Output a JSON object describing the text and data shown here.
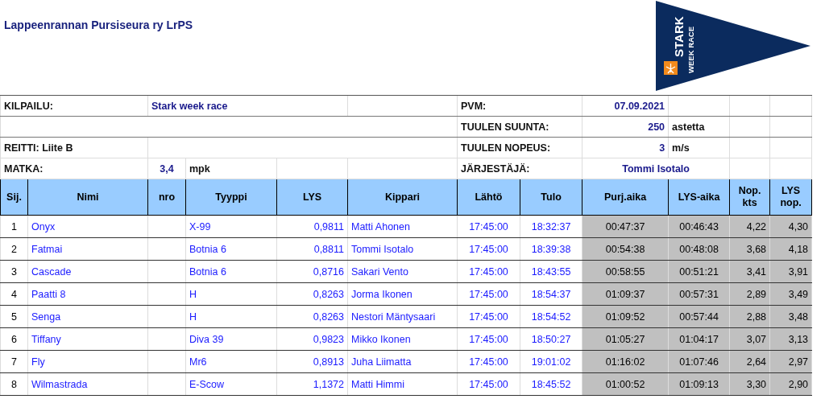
{
  "title": "Lappeenrannan Pursiseura ry LrPS",
  "logo": {
    "line_1": "STARK",
    "line_2": "WEEK RACE"
  },
  "race_info": {
    "race_label": "KILPAILU:",
    "race_name": "Stark week race",
    "route": "REITTI: Liite B",
    "distance_label": "MATKA:",
    "distance": "3,4",
    "distance_unit": "mpk",
    "date_label": "PVM:",
    "date": "07.09.2021",
    "wind_direction_label": "TUULEN SUUNTA:",
    "wind_direction": "250",
    "wind_direction_unit": "astetta",
    "wind_speed_label": "TUULEN NOPEUS:",
    "wind_speed": "3",
    "wind_speed_unit": "m/s",
    "organizer_label": "JÄRJESTÄJÄ:",
    "organizer": "Tommi Isotalo"
  },
  "table": {
    "columns": [
      "Sij.",
      "Nimi",
      "nro",
      "Tyyppi",
      "LYS",
      "Kippari",
      "Lähtö",
      "Tulo",
      "Purj.aika",
      "LYS-aika",
      "Nop. kts",
      "LYS nop."
    ],
    "rows": [
      [
        "1",
        "Onyx",
        "",
        "X-99",
        "0,9811",
        "Matti Ahonen",
        "17:45:00",
        "18:32:37",
        "00:47:37",
        "00:46:43",
        "4,22",
        "4,30"
      ],
      [
        "2",
        "Fatmai",
        "",
        "Botnia 6",
        "0,8811",
        "Tommi Isotalo",
        "17:45:00",
        "18:39:38",
        "00:54:38",
        "00:48:08",
        "3,68",
        "4,18"
      ],
      [
        "3",
        "Cascade",
        "",
        "Botnia 6",
        "0,8716",
        "Sakari Vento",
        "17:45:00",
        "18:43:55",
        "00:58:55",
        "00:51:21",
        "3,41",
        "3,91"
      ],
      [
        "4",
        "Paatti 8",
        "",
        "H",
        "0,8263",
        "Jorma Ikonen",
        "17:45:00",
        "18:54:37",
        "01:09:37",
        "00:57:31",
        "2,89",
        "3,49"
      ],
      [
        "5",
        "Senga",
        "",
        "H",
        "0,8263",
        "Nestori Mäntysaari",
        "17:45:00",
        "18:54:52",
        "01:09:52",
        "00:57:44",
        "2,88",
        "3,48"
      ],
      [
        "6",
        "Tiffany",
        "",
        "Diva 39",
        "0,9823",
        "Mikko Ikonen",
        "17:45:00",
        "18:50:27",
        "01:05:27",
        "01:04:17",
        "3,07",
        "3,13"
      ],
      [
        "7",
        "Fly",
        "",
        "Mr6",
        "0,8913",
        "Juha Liimatta",
        "17:45:00",
        "19:01:02",
        "01:16:02",
        "01:07:46",
        "2,64",
        "2,97"
      ],
      [
        "8",
        "Wilmastrada",
        "",
        "E-Scow",
        "1,1372",
        "Matti Himmi",
        "17:45:00",
        "18:45:52",
        "01:00:52",
        "01:09:13",
        "3,30",
        "2,90"
      ]
    ]
  }
}
